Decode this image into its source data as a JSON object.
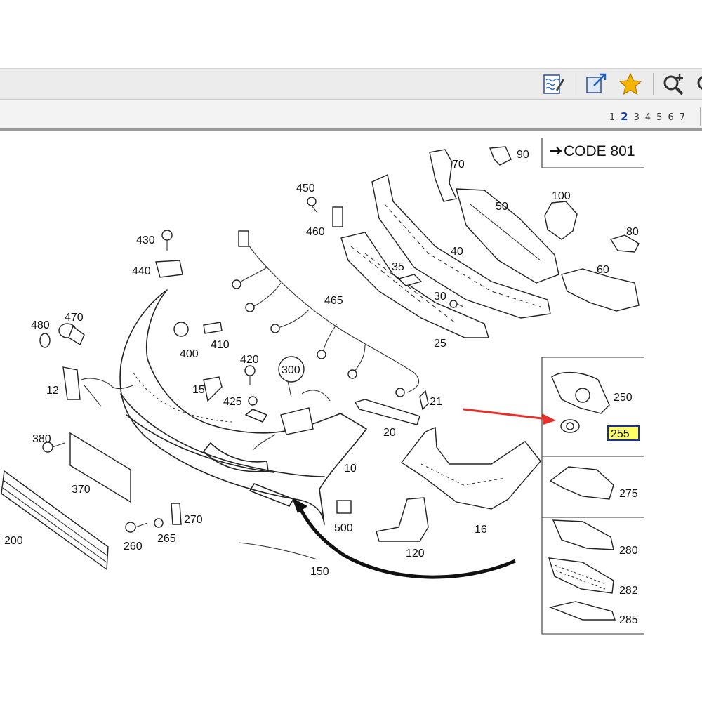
{
  "toolbar": {
    "icons": [
      "annotate-icon",
      "fit-page-icon",
      "favorite-star-icon",
      "zoom-in-icon"
    ]
  },
  "pager": {
    "pages": [
      "1",
      "2",
      "3",
      "4",
      "5",
      "6",
      "7"
    ],
    "active_page": "2"
  },
  "diagram": {
    "code_label": "CODE 801",
    "highlight_color": "#ffff66",
    "highlight_border": "#1a2f9e",
    "arrow_color": "#e8302a",
    "labels": {
      "p10": "10",
      "p12": "12",
      "p15": "15",
      "p16": "16",
      "p20": "20",
      "p21": "21",
      "p25": "25",
      "p30": "30",
      "p35": "35",
      "p40": "40",
      "p50": "50",
      "p60": "60",
      "p70": "70",
      "p80": "80",
      "p90": "90",
      "p100": "100",
      "p120": "120",
      "p150": "150",
      "p200": "200",
      "p250": "250",
      "p255": "255",
      "p260": "260",
      "p265": "265",
      "p270": "270",
      "p275": "275",
      "p280": "280",
      "p282": "282",
      "p285": "285",
      "p300": "300",
      "p370": "370",
      "p380": "380",
      "p400": "400",
      "p410": "410",
      "p420": "420",
      "p425": "425",
      "p430": "430",
      "p440": "440",
      "p450": "450",
      "p460": "460",
      "p465": "465",
      "p470": "470",
      "p480": "480",
      "p500": "500"
    }
  }
}
